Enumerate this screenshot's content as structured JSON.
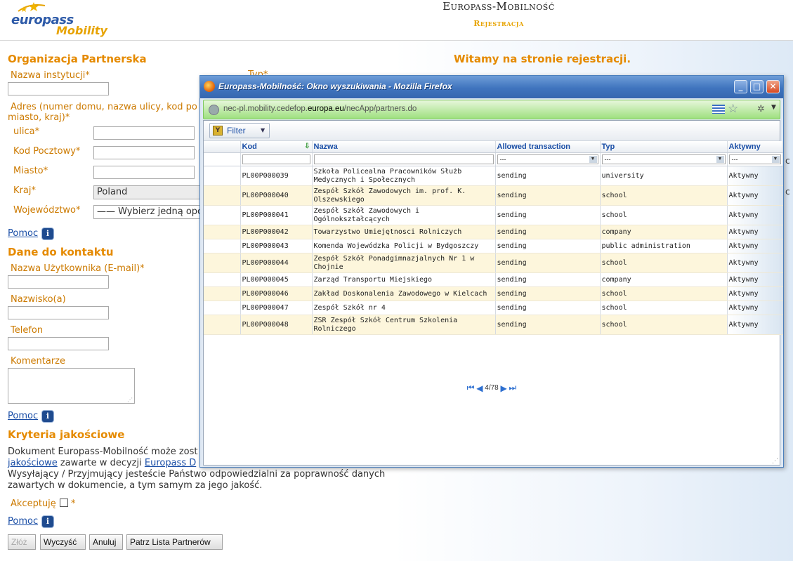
{
  "header": {
    "logo_text_1": "europass",
    "logo_text_2": "Mobility",
    "title": "Europass-Mobilność",
    "subtitle": "Rejestracja"
  },
  "welcome": "Witamy na stronie rejestracji.",
  "partner_org": {
    "heading": "Organizacja Partnerska",
    "institution_label": "Nazwa instytucji*",
    "type_label": "Typ*",
    "address_label": "Adres (numer domu, nazwa ulicy, kod pocztowy, miasto, kraj)*",
    "address_label_line1": "Adres (numer domu, nazwa ulicy, kod po",
    "address_label_line2": "miasto, kraj)*",
    "street_label": "ulica*",
    "postal_label": "Kod Pocztowy*",
    "city_label": "Miasto*",
    "country_label": "Kraj*",
    "country_value": "Poland",
    "voivodeship_label": "Województwo*",
    "voivodeship_value": "—— Wybierz jedną opc",
    "help_link": "Pomoc"
  },
  "contact": {
    "heading": "Dane do kontaktu",
    "username_label": "Nazwa Użytkownika (E-mail)*",
    "surname_label": "Nazwisko(a)",
    "phone_label": "Telefon",
    "comments_label": "Komentarze",
    "help_link": "Pomoc"
  },
  "quality": {
    "heading": "Kryteria jakościowe",
    "text_line1": "Dokument Europass-Mobilność może zost",
    "text_link1": "jakościowe",
    "text_line2_mid": " zawarte w decyzji ",
    "text_link2": "Europass D",
    "text_line3": "Wysyłający / Przyjmujący jesteście Państwo odpowiedzialni za poprawność danych",
    "text_line4": "zawartych w dokumencie, a tym samym za jego jakość.",
    "accept_label": "Akceptuję",
    "accept_star": "*",
    "help_link": "Pomoc"
  },
  "buttons": {
    "submit": "Złóż",
    "clear": "Wyczyść",
    "cancel": "Anuluj",
    "partners_list": "Patrz Lista Partnerów"
  },
  "popup": {
    "title": "Europass-Mobilność: Okno wyszukiwania - Mozilla Firefox",
    "url_prefix": "nec-pl.mobility.cedefop.",
    "url_domain": "europa.eu",
    "url_suffix": "/necApp/partners.do",
    "filter_label": "Filter",
    "columns": [
      "Kod",
      "Nazwa",
      "Allowed transaction",
      "Typ",
      "Aktywny"
    ],
    "filter_select_value": "---",
    "rows": [
      {
        "kod": "PL00P000039",
        "nazwa": "Szkoła Policealna Pracowników Służb Medycznych i Społecznych",
        "trans": "sending",
        "typ": "university",
        "aktywny": "Aktywny"
      },
      {
        "kod": "PL00P000040",
        "nazwa": "Zespół Szkół Zawodowych im. prof. K. Olszewskiego",
        "trans": "sending",
        "typ": "school",
        "aktywny": "Aktywny"
      },
      {
        "kod": "PL00P000041",
        "nazwa": "Zespół Szkół Zawodowych i Ogólnokształcących",
        "trans": "sending",
        "typ": "school",
        "aktywny": "Aktywny"
      },
      {
        "kod": "PL00P000042",
        "nazwa": "Towarzystwo Umiejętnosci Rolniczych",
        "trans": "sending",
        "typ": "company",
        "aktywny": "Aktywny"
      },
      {
        "kod": "PL00P000043",
        "nazwa": "Komenda Wojewódzka Policji w Bydgoszczy",
        "trans": "sending",
        "typ": "public administration",
        "aktywny": "Aktywny"
      },
      {
        "kod": "PL00P000044",
        "nazwa": "Zespół Szkół Ponadgimnazjalnych Nr 1 w Chojnie",
        "trans": "sending",
        "typ": "school",
        "aktywny": "Aktywny"
      },
      {
        "kod": "PL00P000045",
        "nazwa": "Zarząd Transportu Miejskiego",
        "trans": "sending",
        "typ": "company",
        "aktywny": "Aktywny"
      },
      {
        "kod": "PL00P000046",
        "nazwa": "Zakład Doskonalenia Zawodowego w Kielcach",
        "trans": "sending",
        "typ": "school",
        "aktywny": "Aktywny"
      },
      {
        "kod": "PL00P000047",
        "nazwa": "Zespół Szkół nr 4",
        "trans": "sending",
        "typ": "school",
        "aktywny": "Aktywny"
      },
      {
        "kod": "PL00P000048",
        "nazwa": "ZSR Zespół Szkół Centrum Szkolenia Rolniczego",
        "trans": "sending",
        "typ": "school",
        "aktywny": "Aktywny"
      }
    ],
    "pager_text": "4/78"
  },
  "colors": {
    "accent_orange": "#e58a00",
    "link_blue": "#1a4ea6",
    "titlebar_blue": "#3f74be",
    "url_green": "#9ee07f",
    "row_alt": "#fdf6dc"
  }
}
